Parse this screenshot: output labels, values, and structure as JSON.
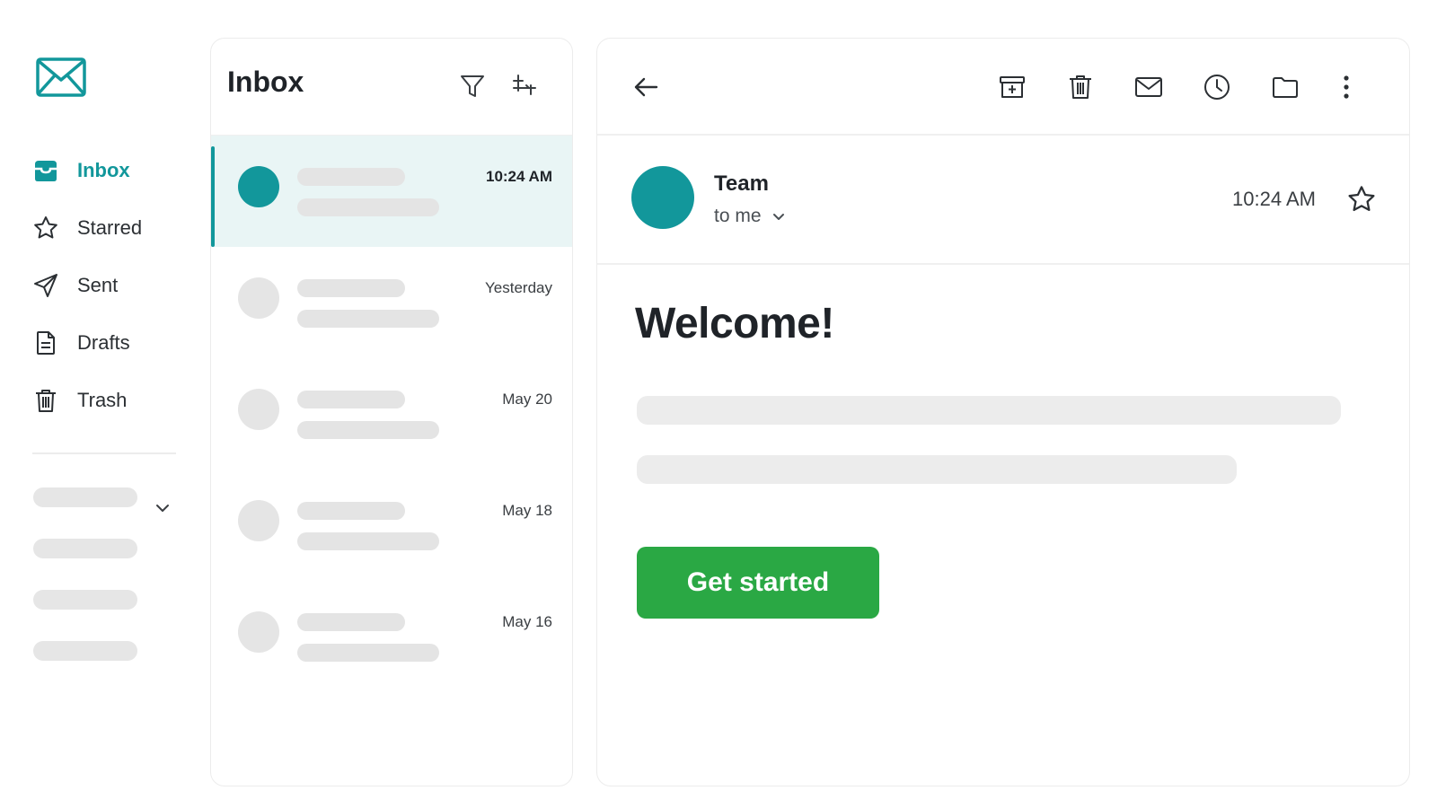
{
  "colors": {
    "accent": "#12979b",
    "selected_row": "#e9f5f5",
    "cta": "#2aa844",
    "skeleton": "#e6e6e6"
  },
  "sidebar": {
    "logo_icon": "envelope-icon",
    "items": [
      {
        "label": "Inbox",
        "icon": "inbox-icon",
        "active": true
      },
      {
        "label": "Starred",
        "icon": "star-icon"
      },
      {
        "label": "Sent",
        "icon": "send-icon"
      },
      {
        "label": "Drafts",
        "icon": "draft-icon"
      },
      {
        "label": "Trash",
        "icon": "trash-icon"
      }
    ]
  },
  "message_list": {
    "title": "Inbox",
    "header_icons": [
      "filter-icon",
      "sort-icon"
    ],
    "messages": [
      {
        "time": "10:24 AM",
        "selected": true
      },
      {
        "time": "Yesterday"
      },
      {
        "time": "May 20"
      },
      {
        "time": "May 18"
      },
      {
        "time": "May 16"
      }
    ]
  },
  "reader": {
    "toolbar_icons": [
      "back-arrow-icon",
      "archive-icon",
      "trash-icon",
      "mail-icon",
      "clock-icon",
      "folder-icon",
      "more-vertical-icon"
    ],
    "sender": {
      "name": "Team",
      "to": "to me",
      "time": "10:24 AM"
    },
    "heading": "Welcome!",
    "cta_label": "Get started"
  }
}
